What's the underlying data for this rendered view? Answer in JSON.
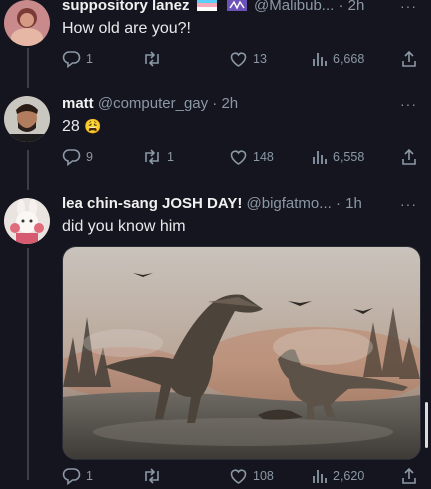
{
  "tweets": [
    {
      "name": "suppository lanez",
      "handle": "@Malibub...",
      "time": "· 2h",
      "text": "How old are you?!",
      "replies": "1",
      "retweets": "",
      "likes": "13",
      "views": "6,668"
    },
    {
      "name": "matt",
      "handle": "@computer_gay",
      "time": "· 2h",
      "text": "28",
      "emoji": "😩",
      "replies": "9",
      "retweets": "1",
      "likes": "148",
      "views": "6,558"
    },
    {
      "name": "lea chin-sang JOSH DAY!",
      "handle": "@bigfatmo...",
      "time": "· 1h",
      "text": "did you know him",
      "replies": "1",
      "retweets": "",
      "likes": "108",
      "views": "2,620"
    }
  ],
  "icons": {
    "more": "more-horizontal-icon",
    "reply": "reply-icon",
    "retweet": "retweet-icon",
    "like": "heart-icon",
    "views": "views-icon",
    "share": "share-icon"
  },
  "colors": {
    "background": "#15151f",
    "muted": "#8b98a5",
    "text": "#e7e9ea"
  }
}
